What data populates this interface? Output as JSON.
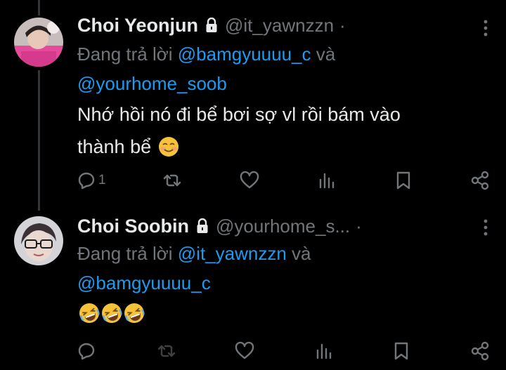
{
  "tweets": [
    {
      "display_name": "Choi Yeonjun",
      "handle": "@it_yawnzzn",
      "separator": "·",
      "reply_prefix": "Đang trả lời ",
      "reply_mention_1": "@bamgyuuuu_c",
      "reply_joiner": " và",
      "reply_mention_2": "@yourhome_soob",
      "text_line_1": "Nhớ hồi nó đi bể bơi sợ vl rồi bám vào",
      "text_line_2": "thành bể",
      "emoji": "smiling-face-icon",
      "reply_count": "1"
    },
    {
      "display_name": "Choi Soobin",
      "handle": "@yourhome_s...",
      "separator": "·",
      "reply_prefix": "Đang trả lời ",
      "reply_mention_1": "@it_yawnzzn",
      "reply_joiner": " và",
      "reply_mention_2": "@bamgyuuuu_c",
      "emoji": "rolling-laughing-icon",
      "emoji_count": 3,
      "reply_count": ""
    }
  ],
  "colors": {
    "background": "#000000",
    "text": "#e7e9ea",
    "muted": "#71767b",
    "link": "#1d9bf0",
    "line": "#333639"
  }
}
